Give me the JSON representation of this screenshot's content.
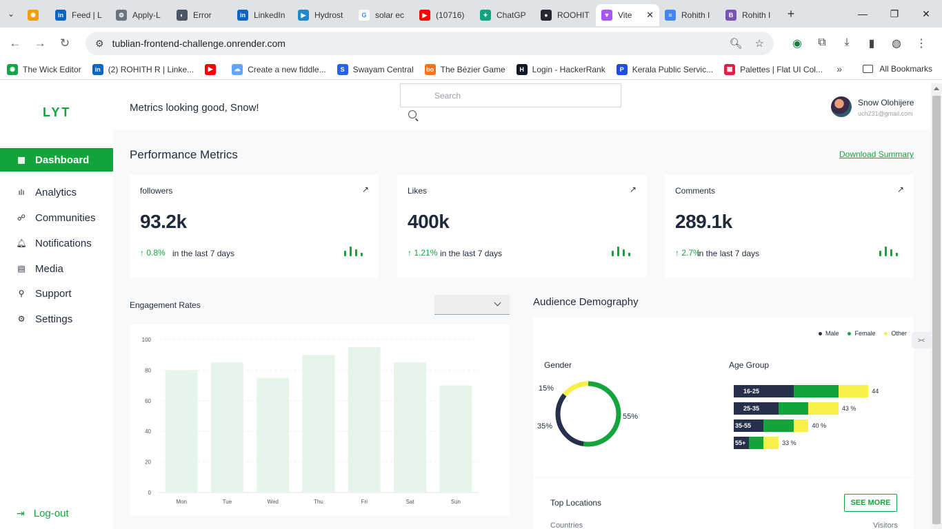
{
  "browser": {
    "tabs": [
      {
        "label": "",
        "favicon": "#f59e0b",
        "glyph": "✺"
      },
      {
        "label": "Feed | L",
        "favicon": "#0a66c2",
        "glyph": "in"
      },
      {
        "label": "Apply-L",
        "favicon": "#6b7280",
        "glyph": "⚙"
      },
      {
        "label": "Error",
        "favicon": "#4b5563",
        "glyph": "◐"
      },
      {
        "label": "LinkedIn",
        "favicon": "#0a66c2",
        "glyph": "in"
      },
      {
        "label": "Hydrost",
        "favicon": "#1e88c8",
        "glyph": "▶"
      },
      {
        "label": "solar ec",
        "favicon": "#ffffff",
        "glyph": "G"
      },
      {
        "label": "(10716)",
        "favicon": "#ff0000",
        "glyph": "▶"
      },
      {
        "label": "ChatGP",
        "favicon": "#10a37f",
        "glyph": "✦"
      },
      {
        "label": "ROOHIT",
        "favicon": "#24292f",
        "glyph": "●"
      },
      {
        "label": "Vite",
        "favicon": "#a855f7",
        "glyph": "▼"
      },
      {
        "label": "Rohith I",
        "favicon": "#4285f4",
        "glyph": "≡"
      },
      {
        "label": "Rohith I",
        "favicon": "#7952b3",
        "glyph": "B"
      }
    ],
    "url": "tublian-frontend-challenge.onrender.com",
    "bookmarks": [
      {
        "label": "The Wick Editor",
        "favicon": "#16a34a",
        "glyph": "◉"
      },
      {
        "label": "(2) ROHITH R | Linke...",
        "favicon": "#0a66c2",
        "glyph": "in"
      },
      {
        "label": "",
        "favicon": "#ff0000",
        "glyph": "▶"
      },
      {
        "label": "Create a new fiddle...",
        "favicon": "#60a5fa",
        "glyph": "☁"
      },
      {
        "label": "Swayam Central",
        "favicon": "#2563eb",
        "glyph": "S"
      },
      {
        "label": "The Bézier Game",
        "favicon": "#f97316",
        "glyph": "bo"
      },
      {
        "label": "Login - HackerRank",
        "favicon": "#111827",
        "glyph": "H"
      },
      {
        "label": "Kerala Public Servic...",
        "favicon": "#1d4ed8",
        "glyph": "P"
      },
      {
        "label": "Palettes | Flat UI Col...",
        "favicon": "#e11d48",
        "glyph": "▦"
      }
    ],
    "all_bookmarks": "All Bookmarks"
  },
  "sidebar": {
    "logo": "LYT",
    "items": [
      {
        "label": "Dashboard",
        "icon": "grid-icon",
        "glyph": "▦",
        "active": true
      },
      {
        "label": "Analytics",
        "icon": "bar-chart-icon",
        "glyph": "ılı",
        "active": false
      },
      {
        "label": "Communities",
        "icon": "users-icon",
        "glyph": "☍",
        "active": false
      },
      {
        "label": "Notifications",
        "icon": "bell-icon",
        "glyph": "🔔︎",
        "active": false
      },
      {
        "label": "Media",
        "icon": "image-icon",
        "glyph": "▤",
        "active": false
      },
      {
        "label": "Support",
        "icon": "pin-icon",
        "glyph": "⚲",
        "active": false
      },
      {
        "label": "Settings",
        "icon": "gear-icon",
        "glyph": "⚙",
        "active": false
      }
    ],
    "logout": "Log-out"
  },
  "header": {
    "greeting": "Metrics looking good, Snow!",
    "search_placeholder": "Search",
    "user_name": "Snow Olohijere",
    "user_email": "uch231@gmail.com"
  },
  "performance": {
    "title": "Performance Metrics",
    "download": "Download Summary",
    "cards": [
      {
        "label": "followers",
        "value": "93.2k",
        "change": "0.8%",
        "period": "in the last 7 days"
      },
      {
        "label": "Likes",
        "value": "400k",
        "change": "1.21%",
        "period": "in the last 7 days"
      },
      {
        "label": "Comments",
        "value": "289.1k",
        "change": "2.7%",
        "period": "in the last 7 days"
      }
    ]
  },
  "engagement": {
    "title": "Engagement Rates",
    "select_value": ""
  },
  "chart_data": {
    "type": "bar",
    "categories": [
      "Mon",
      "Tue",
      "Wed",
      "Thu",
      "Fri",
      "Sat",
      "Sun"
    ],
    "values": [
      80,
      85,
      75,
      90,
      95,
      85,
      70
    ],
    "ylim": [
      0,
      100
    ],
    "yticks": [
      0,
      20,
      40,
      60,
      80,
      100
    ],
    "grid": true,
    "bar_color": "#e6f5ea"
  },
  "demography": {
    "title": "Audience Demography",
    "legend": [
      {
        "label": "Male",
        "color": "#26304a"
      },
      {
        "label": "Female",
        "color": "#13a53c"
      },
      {
        "label": "Other",
        "color": "#f9ef4a"
      }
    ],
    "gender_title": "Gender",
    "gender": [
      {
        "label": "55%",
        "value": 55,
        "color": "#13a53c"
      },
      {
        "label": "35%",
        "value": 35,
        "color": "#26304a"
      },
      {
        "label": "15%",
        "value": 15,
        "color": "#f9ef4a"
      }
    ],
    "age_title": "Age Group",
    "age_groups": [
      {
        "label": "16-25",
        "male": 40,
        "female": 30,
        "other": 20,
        "value": "44"
      },
      {
        "label": "25-35",
        "male": 30,
        "female": 20,
        "other": 20,
        "value": "43 %"
      },
      {
        "label": "35-55",
        "male": 20,
        "female": 20,
        "other": 10,
        "value": "40 %"
      },
      {
        "label": "55+",
        "male": 10,
        "female": 10,
        "other": 10,
        "value": "33 %"
      }
    ]
  },
  "locations": {
    "title": "Top Locations",
    "see_more": "SEE MORE",
    "col_countries": "Countries",
    "col_visitors": "Visitors"
  }
}
